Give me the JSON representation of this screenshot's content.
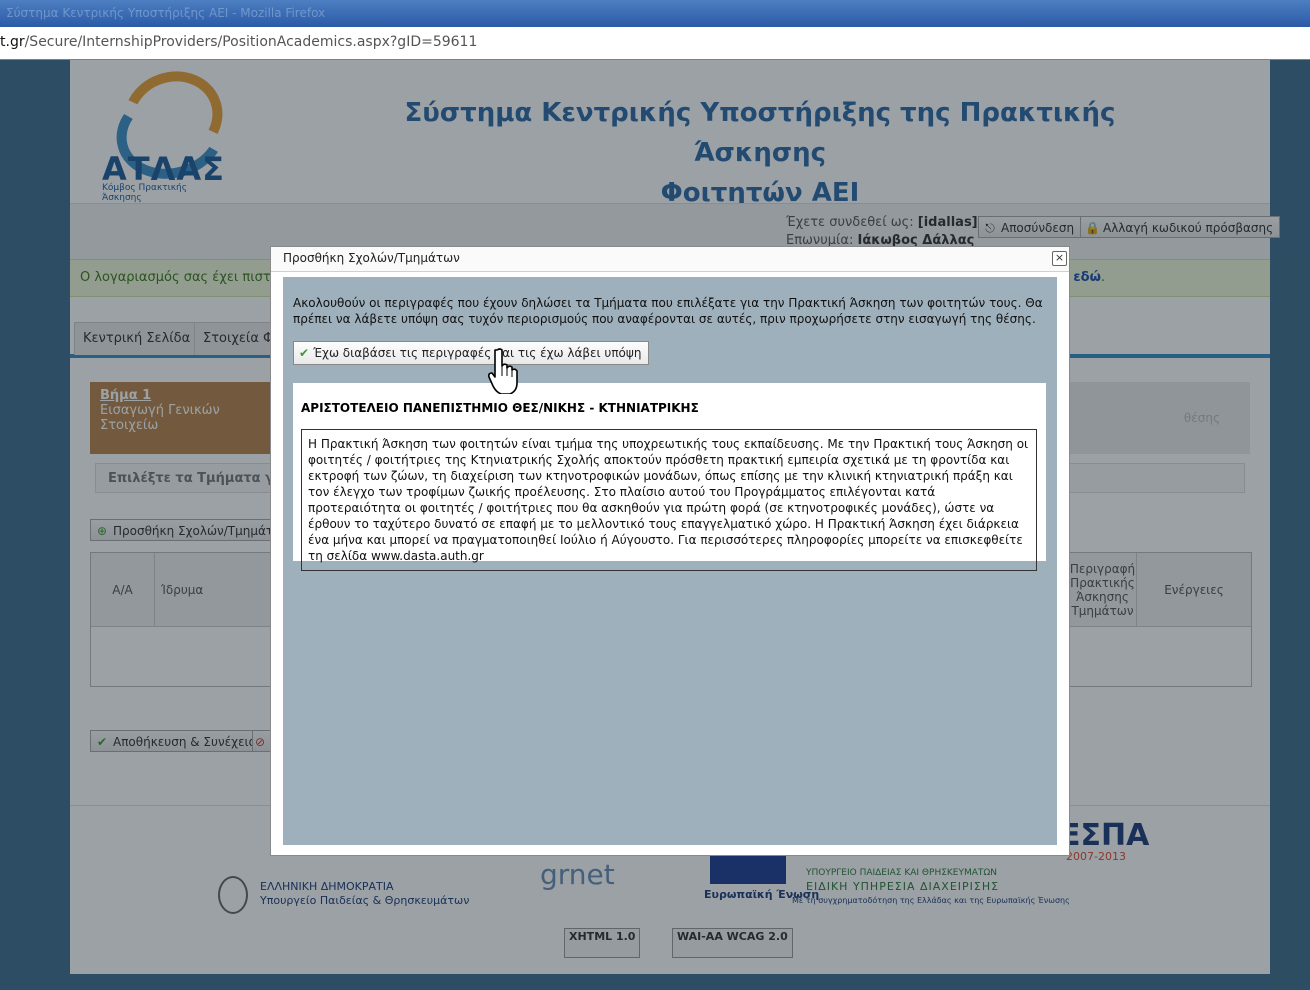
{
  "browser": {
    "title": "Σύστημα Κεντρικής Υποστήριξης ΑΕΙ - Mozilla Firefox",
    "url_host": "t.gr",
    "url_path": "/Secure/InternshipProviders/PositionAcademics.aspx?gID=59611"
  },
  "header": {
    "logo_text": "ΑΤΛΑΣ",
    "logo_tagline": "Κόμβος Πρακτικής Άσκησης",
    "title_line1": "Σύστημα Κεντρικής Υποστήριξης της Πρακτικής Άσκησης",
    "title_line2": "Φοιτητών ΑΕΙ"
  },
  "user": {
    "logged_in_label": "Έχετε συνδεθεί ως:",
    "username": "[idallas]",
    "name_label": "Επωνυμία:",
    "name": "Ιάκωβος Δάλλας",
    "logout_label": "Αποσύνδεση",
    "change_password_label": "Αλλαγή κωδικού πρόσβασης"
  },
  "notice": {
    "lead": "Ο λογαριασμός σας έχει πιστοπ",
    "tail_prefix": "ν",
    "tail_link": "εδώ",
    "tail_suffix": "."
  },
  "tabs": [
    {
      "label": "Κεντρική Σελίδα"
    },
    {
      "label": "Στοιχεία Φο"
    }
  ],
  "steps": {
    "step1_title": "Βήμα 1",
    "step1_text": "Εισαγωγή Γενικών Στοιχείω",
    "step_right_text": "θέσης"
  },
  "select_prompt": "Επιλέξτε τα Τμήματα για τ",
  "add_schools_label": "Προσθήκη Σχολών/Τμημάτων",
  "table": {
    "headers": [
      "Α/Α",
      "Ίδρυμα",
      "Περιγραφή Πρακτικής Άσκησης Τμημάτων",
      "Ενέργειες"
    ]
  },
  "save_continue_label": "Αποθήκευση & Συνέχεια",
  "footer": {
    "greece_line1": "ΕΛΛΗΝΙΚΗ ΔΗΜΟΚΡΑΤΙΑ",
    "greece_line2": "Υπουργείο Παιδείας & Θρησκευμάτων",
    "grnet": "grnet",
    "eu_line1": "Ευρωπαϊκή Ένωση",
    "ministry_line1": "ΥΠΟΥΡΓΕΙΟ ΠΑΙΔΕΙΑΣ ΚΑΙ ΘΡΗΣΚΕΥΜΑΤΩΝ",
    "ministry_line2": "ΕΙΔΙΚΗ ΥΠΗΡΕΣΙΑ ΔΙΑΧΕΙΡΙΣΗΣ",
    "cofund": "Με τη συγχρηματοδότηση της Ελλάδας και της Ευρωπαϊκής Ένωσης",
    "espa": "ΕΣΠΑ",
    "espa_years": "2007-2013",
    "w3c_xhtml": "XHTML 1.0",
    "w3c_wcag": "WAI-AA WCAG 2.0"
  },
  "modal": {
    "title": "Προσθήκη Σχολών/Τμημάτων",
    "close_glyph": "×",
    "intro": "Ακολουθούν οι περιγραφές που έχουν δηλώσει τα Τμήματα που επιλέξατε για την Πρακτική Άσκηση των φοιτητών τους. Θα πρέπει να λάβετε υπόψη σας τυχόν περιορισμούς που αναφέρονται σε αυτές, πριν προχωρήσετε στην εισαγωγή της θέσης.",
    "ack_button": "Έχω διαβάσει τις περιγραφές και τις έχω λάβει υπόψη",
    "university": "ΑΡΙΣΤΟΤΕΛΕΙΟ ΠΑΝΕΠΙΣΤΗΜΙΟ ΘΕΣ/ΝΙΚΗΣ - ΚΤΗΝΙΑΤΡΙΚΗΣ",
    "description": "Η Πρακτική Άσκηση των φοιτητών είναι τμήμα της υποχρεωτικής τους εκπαίδευσης. Με την Πρακτική τους Άσκηση οι φοιτητές / φοιτήτριες της Κτηνιατρικής Σχολής αποκτούν πρόσθετη πρακτική εμπειρία σχετικά με τη φροντίδα και εκτροφή των ζώων, τη διαχείριση των κτηνοτροφικών μονάδων, όπως επίσης με την κλινική κτηνιατρική πράξη και τον έλεγχο των τροφίμων ζωικής προέλευσης. Στο πλαίσιο αυτού του Προγράμματος επιλέγονται κατά προτεραιότητα οι φοιτητές / φοιτήτριες που θα ασκηθούν για πρώτη φορά (σε κτηνοτροφικές μονάδες), ώστε να έρθουν το ταχύτερο δυνατό σε επαφή με το μελλοντικό τους επαγγελματικό χώρο. Η Πρακτική Άσκηση έχει διάρκεια ένα μήνα και μπορεί να πραγματοποιηθεί Ιούλιο ή Αύγουστο. Για περισσότερες πληροφορίες μπορείτε να επισκεφθείτε τη σελίδα www.dasta.auth.gr"
  },
  "colors": {
    "modal_body_bg": "#9db0bb",
    "title_blue": "#2f6aa6",
    "step_active": "#b8864e",
    "notice_green": "#3b7a1c"
  }
}
